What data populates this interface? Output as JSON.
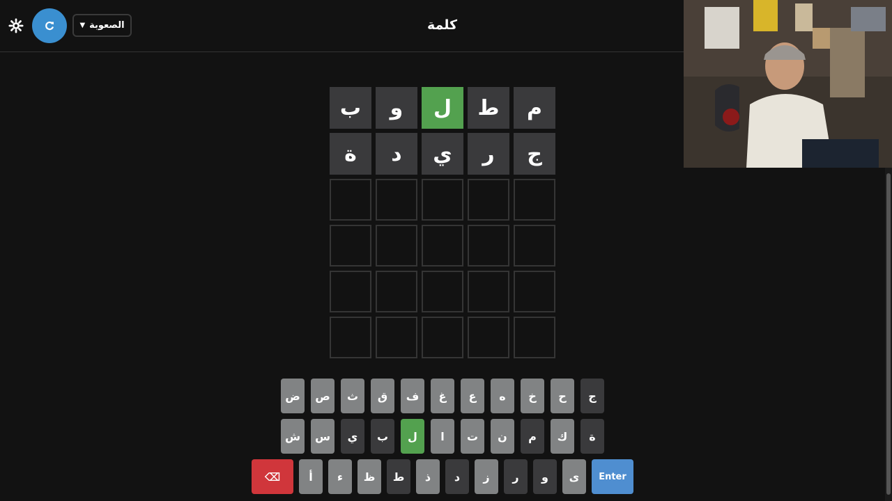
{
  "header": {
    "title": "كلمة",
    "difficulty_label": "الصعوبة",
    "refresh_icon": "refresh-icon",
    "settings_icon": "gear-icon"
  },
  "board": {
    "rows": [
      [
        {
          "letter": "م",
          "state": "absent"
        },
        {
          "letter": "ط",
          "state": "absent"
        },
        {
          "letter": "ل",
          "state": "correct"
        },
        {
          "letter": "و",
          "state": "absent"
        },
        {
          "letter": "ب",
          "state": "absent"
        }
      ],
      [
        {
          "letter": "ج",
          "state": "absent"
        },
        {
          "letter": "ر",
          "state": "absent"
        },
        {
          "letter": "ي",
          "state": "absent"
        },
        {
          "letter": "د",
          "state": "absent"
        },
        {
          "letter": "ة",
          "state": "absent"
        }
      ],
      [
        {
          "letter": "",
          "state": "empty"
        },
        {
          "letter": "",
          "state": "empty"
        },
        {
          "letter": "",
          "state": "empty"
        },
        {
          "letter": "",
          "state": "empty"
        },
        {
          "letter": "",
          "state": "empty"
        }
      ],
      [
        {
          "letter": "",
          "state": "empty"
        },
        {
          "letter": "",
          "state": "empty"
        },
        {
          "letter": "",
          "state": "empty"
        },
        {
          "letter": "",
          "state": "empty"
        },
        {
          "letter": "",
          "state": "empty"
        }
      ],
      [
        {
          "letter": "",
          "state": "empty"
        },
        {
          "letter": "",
          "state": "empty"
        },
        {
          "letter": "",
          "state": "empty"
        },
        {
          "letter": "",
          "state": "empty"
        },
        {
          "letter": "",
          "state": "empty"
        }
      ],
      [
        {
          "letter": "",
          "state": "empty"
        },
        {
          "letter": "",
          "state": "empty"
        },
        {
          "letter": "",
          "state": "empty"
        },
        {
          "letter": "",
          "state": "empty"
        },
        {
          "letter": "",
          "state": "empty"
        }
      ]
    ]
  },
  "keyboard": {
    "rows": [
      [
        {
          "k": "ج",
          "state": "absent"
        },
        {
          "k": "ح",
          "state": "unused"
        },
        {
          "k": "خ",
          "state": "unused"
        },
        {
          "k": "ه",
          "state": "unused"
        },
        {
          "k": "ع",
          "state": "unused"
        },
        {
          "k": "غ",
          "state": "unused"
        },
        {
          "k": "ف",
          "state": "unused"
        },
        {
          "k": "ق",
          "state": "unused"
        },
        {
          "k": "ث",
          "state": "unused"
        },
        {
          "k": "ص",
          "state": "unused"
        },
        {
          "k": "ض",
          "state": "unused"
        }
      ],
      [
        {
          "k": "ة",
          "state": "absent"
        },
        {
          "k": "ك",
          "state": "unused"
        },
        {
          "k": "م",
          "state": "absent"
        },
        {
          "k": "ن",
          "state": "unused"
        },
        {
          "k": "ت",
          "state": "unused"
        },
        {
          "k": "ا",
          "state": "unused"
        },
        {
          "k": "ل",
          "state": "correct"
        },
        {
          "k": "ب",
          "state": "absent"
        },
        {
          "k": "ي",
          "state": "absent"
        },
        {
          "k": "س",
          "state": "unused"
        },
        {
          "k": "ش",
          "state": "unused"
        }
      ],
      [
        {
          "k": "Enter",
          "state": "enter"
        },
        {
          "k": "ى",
          "state": "unused"
        },
        {
          "k": "و",
          "state": "absent"
        },
        {
          "k": "ر",
          "state": "absent"
        },
        {
          "k": "ز",
          "state": "unused"
        },
        {
          "k": "د",
          "state": "absent"
        },
        {
          "k": "ذ",
          "state": "unused"
        },
        {
          "k": "ط",
          "state": "absent"
        },
        {
          "k": "ظ",
          "state": "unused"
        },
        {
          "k": "ء",
          "state": "unused"
        },
        {
          "k": "أ",
          "state": "unused"
        },
        {
          "k": "⌫",
          "state": "back"
        }
      ]
    ]
  },
  "colors": {
    "correct": "#53a14f",
    "absent": "#3a3a3c",
    "unused": "#818384",
    "enter": "#4f8ed0",
    "backspace": "#d0363b",
    "accent": "#3a8fd0"
  }
}
